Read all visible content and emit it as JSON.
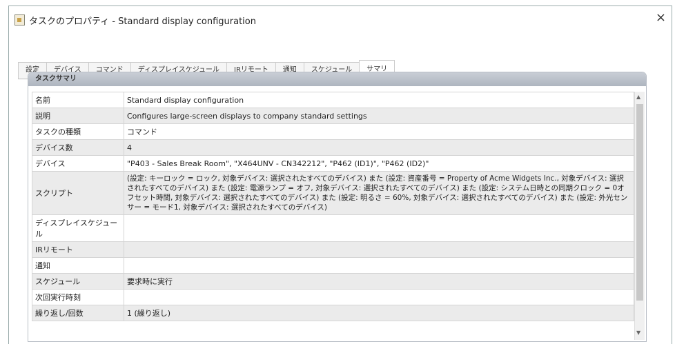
{
  "window": {
    "title": "タスクのプロパティ - Standard display configuration",
    "close": "×"
  },
  "tabs": [
    {
      "label": "設定"
    },
    {
      "label": "デバイス"
    },
    {
      "label": "コマンド"
    },
    {
      "label": "ディスプレイスケジュール"
    },
    {
      "label": "IRリモート"
    },
    {
      "label": "通知"
    },
    {
      "label": "スケジュール"
    },
    {
      "label": "サマリ"
    }
  ],
  "panel": {
    "title": "タスクサマリ"
  },
  "rows": [
    {
      "label": "名前",
      "value": "Standard display configuration"
    },
    {
      "label": "説明",
      "value": "Configures large-screen displays to company standard settings"
    },
    {
      "label": "タスクの種類",
      "value": "コマンド"
    },
    {
      "label": "デバイス数",
      "value": "4"
    },
    {
      "label": "デバイス",
      "value": "\"P403 - Sales Break Room\", \"X464UNV - CN342212\", \"P462 (ID1)\", \"P462 (ID2)\""
    },
    {
      "label": "スクリプト",
      "value": "(設定: キーロック = ロック, 対象デバイス: 選択されたすべてのデバイス) また (設定: 資産番号 = Property of Acme Widgets Inc., 対象デバイス: 選択されたすべてのデバイス) また (設定: 電源ランプ = オフ, 対象デバイス: 選択されたすべてのデバイス) また (設定: システム日時との同期クロック = 0オフセット時間, 対象デバイス: 選択されたすべてのデバイス) また (設定: 明るさ = 60%, 対象デバイス: 選択されたすべてのデバイス) また (設定: 外光センサー = モード1, 対象デバイス: 選択されたすべてのデバイス)"
    },
    {
      "label": "ディスプレイスケジュール",
      "value": ""
    },
    {
      "label": "IRリモート",
      "value": ""
    },
    {
      "label": "通知",
      "value": ""
    },
    {
      "label": "スケジュール",
      "value": "要求時に実行"
    },
    {
      "label": "次回実行時刻",
      "value": ""
    },
    {
      "label": "繰り返し/回数",
      "value": "1 (繰り返し)"
    }
  ]
}
